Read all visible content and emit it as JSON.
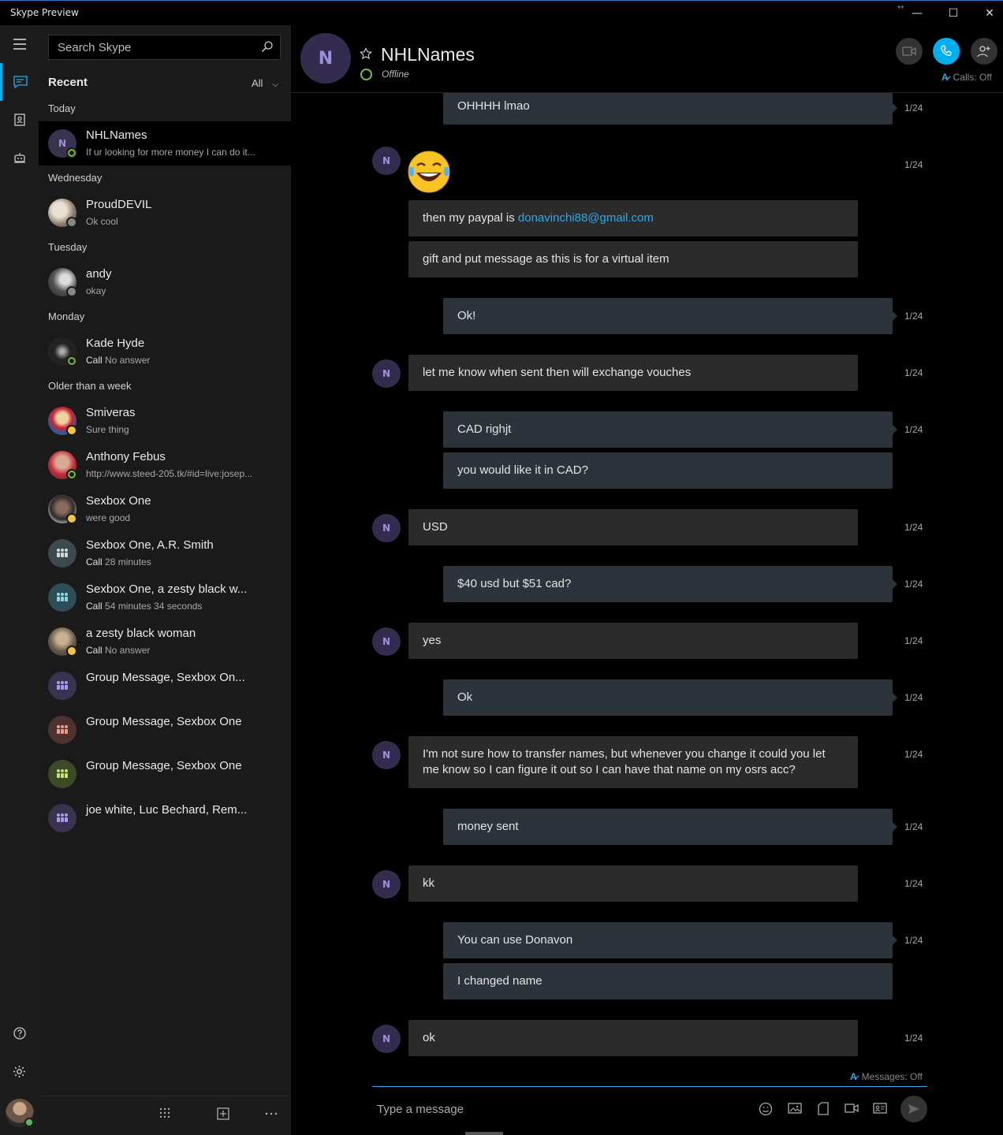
{
  "window": {
    "title": "Skype Preview",
    "minimize": "—",
    "maximize": "☐",
    "close": "✕"
  },
  "search": {
    "placeholder": "Search Skype"
  },
  "recent": {
    "title": "Recent",
    "filter": "All"
  },
  "sections": {
    "today": "Today",
    "wednesday": "Wednesday",
    "tuesday": "Tuesday",
    "monday": "Monday",
    "older": "Older than a week"
  },
  "contacts": [
    {
      "name": "NHLNames",
      "message": "If ur looking for more money I can do it...",
      "status": "online",
      "avatar": "N"
    },
    {
      "name": "ProudDEVIL",
      "message": "Ok cool",
      "status": "unknown"
    },
    {
      "name": "andy",
      "message": "okay",
      "status": "unknown"
    },
    {
      "name": "Kade Hyde",
      "msg_bold": "Call",
      "message": "No answer",
      "status": "online"
    },
    {
      "name": "Smiveras",
      "message": "Sure thing",
      "status": "away"
    },
    {
      "name": "Anthony Febus",
      "message": "http://www.steed-205.tk/#id=live:josep...",
      "status": "online"
    },
    {
      "name": "Sexbox One",
      "message": "were good",
      "status": "away"
    },
    {
      "name": "Sexbox One, A.R. Smith",
      "msg_bold": "Call",
      "message": "28 minutes",
      "status": "group"
    },
    {
      "name": "Sexbox One, a zesty black w...",
      "msg_bold": "Call",
      "message": "54 minutes 34 seconds",
      "status": "group"
    },
    {
      "name": "a zesty black woman",
      "msg_bold": "Call",
      "message": "No answer",
      "status": "away"
    },
    {
      "name": "Group Message, Sexbox On...",
      "message": "",
      "status": "group"
    },
    {
      "name": "Group Message, Sexbox One",
      "message": "",
      "status": "group"
    },
    {
      "name": "Group Message, Sexbox One",
      "message": "",
      "status": "group"
    },
    {
      "name": "joe white, Luc Bechard, Rem...",
      "message": "",
      "status": "group"
    }
  ],
  "chat": {
    "avatar": "N",
    "name": "NHLNames",
    "status": "Offline",
    "calls_label": "Calls: Off",
    "messages_label": "Messages: Off",
    "compose_placeholder": "Type a message",
    "messages": [
      {
        "dir": "out",
        "text": "OHHHH lmao",
        "time": "1/24"
      },
      {
        "dir": "in",
        "emoji": "laughing-tears",
        "time": "1/24"
      },
      {
        "dir": "in",
        "text": "then my paypal is ",
        "link": "donavinchi88@gmail.com"
      },
      {
        "dir": "in",
        "text": "gift and put message as this is for a virtual item"
      },
      {
        "dir": "out",
        "text": "Ok!",
        "time": "1/24"
      },
      {
        "dir": "in",
        "text": "let me know when sent then will exchange vouches",
        "time": "1/24"
      },
      {
        "dir": "out",
        "text": "CAD righjt",
        "time": "1/24"
      },
      {
        "dir": "out",
        "text": "you would like it in CAD?"
      },
      {
        "dir": "in",
        "text": "USD",
        "time": "1/24"
      },
      {
        "dir": "out",
        "text": "$40 usd but $51 cad?",
        "time": "1/24"
      },
      {
        "dir": "in",
        "text": "yes",
        "time": "1/24"
      },
      {
        "dir": "out",
        "text": "Ok",
        "time": "1/24"
      },
      {
        "dir": "in",
        "text": "I'm not sure how to transfer names, but whenever you change it could you let me know so I can figure it out so I can have that name on my osrs acc?",
        "time": "1/24"
      },
      {
        "dir": "out",
        "text": "money sent",
        "time": "1/24"
      },
      {
        "dir": "in",
        "text": "kk",
        "time": "1/24"
      },
      {
        "dir": "out",
        "text": "You can use Donavon",
        "time": "1/24"
      },
      {
        "dir": "out",
        "text": "I changed name"
      },
      {
        "dir": "in",
        "text": "ok",
        "time": "1/24"
      }
    ]
  },
  "colors": {
    "accent": "#00aff0",
    "link": "#2ea8e6",
    "online": "#7ac143",
    "away": "#f5c542"
  }
}
